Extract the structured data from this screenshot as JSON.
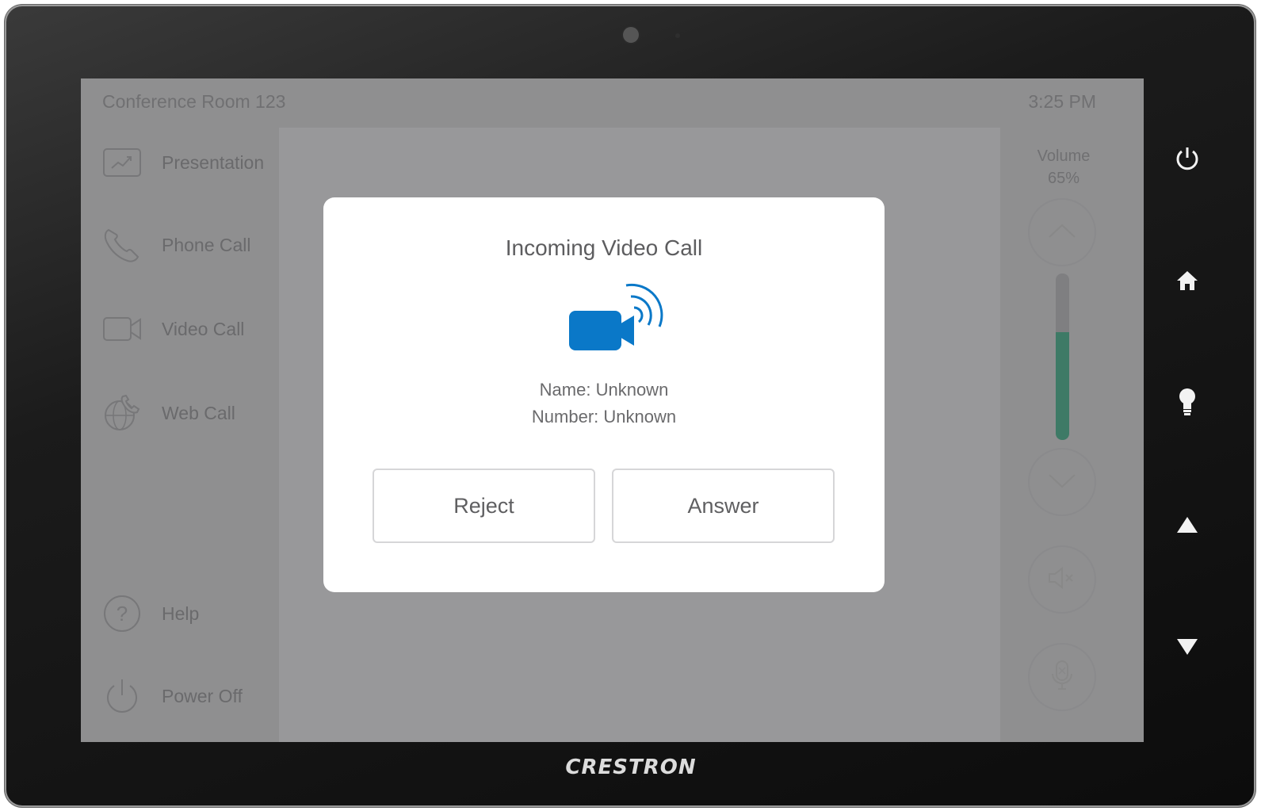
{
  "device": {
    "brand": "CRESTRON",
    "hardware_buttons": [
      "power-icon",
      "home-icon",
      "lightbulb-icon",
      "arrow-up-icon",
      "arrow-down-icon"
    ]
  },
  "header": {
    "room_name": "Conference Room 123",
    "time": "3:25 PM"
  },
  "sidebar": {
    "items": [
      {
        "label": "Presentation",
        "icon": "presentation-icon"
      },
      {
        "label": "Phone Call",
        "icon": "phone-icon"
      },
      {
        "label": "Video Call",
        "icon": "video-camera-icon"
      },
      {
        "label": "Web Call",
        "icon": "web-call-icon"
      },
      {
        "label": "Help",
        "icon": "help-icon"
      },
      {
        "label": "Power Off",
        "icon": "power-icon"
      }
    ]
  },
  "volume": {
    "label": "Volume",
    "value_text": "65%",
    "level": 0.65,
    "fill_color": "#3e7a66"
  },
  "modal": {
    "title": "Incoming Video Call",
    "name_line": "Name: Unknown",
    "number_line": "Number: Unknown",
    "reject_label": "Reject",
    "answer_label": "Answer",
    "icon": "incoming-video-call-icon",
    "icon_color": "#0a78c8"
  }
}
